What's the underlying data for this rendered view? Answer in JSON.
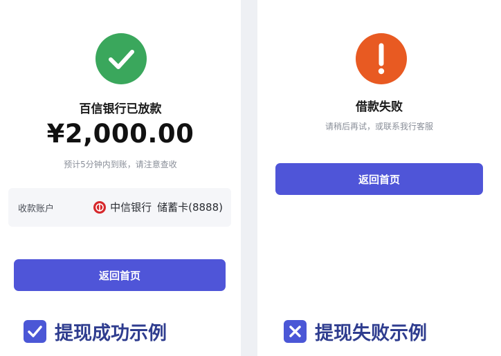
{
  "success_screen": {
    "title": "百信银行已放款",
    "amount": "¥2,000.00",
    "hint": "预计5分钟内到账，请注意查收",
    "account_label": "收款账户",
    "bank_name": "中信银行",
    "card_info": "储蓄卡(8888)",
    "return_button_label": "返回首页",
    "status_color": "#3aa75c"
  },
  "failure_screen": {
    "title": "借款失败",
    "hint": "请稍后再试，或联系我行客服",
    "return_button_label": "返回首页",
    "status_color": "#e85a22"
  },
  "captions": {
    "success": "提现成功示例",
    "failure": "提现失败示例"
  },
  "icons": {
    "success_status": "check-circle-icon",
    "failure_status": "exclamation-circle-icon",
    "bank_logo": "citic-bank-logo",
    "caption_success": "checkbox-check-icon",
    "caption_failure": "checkbox-x-icon"
  },
  "colors": {
    "primary_button": "#4f55d8",
    "caption_text": "#2f3d8f"
  }
}
